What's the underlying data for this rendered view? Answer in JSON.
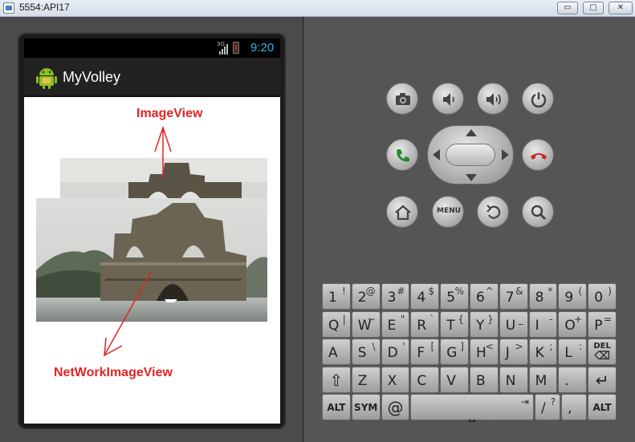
{
  "window": {
    "title": "5554:API17",
    "minimize_glyph": "▭",
    "maximize_glyph": "▢",
    "close_glyph": "✕"
  },
  "statusbar": {
    "network_type": "3G",
    "time": "9:20",
    "clock_color": "#33b5e5"
  },
  "actionbar": {
    "app_title": "MyVolley",
    "icon": "android-icon"
  },
  "annotations": {
    "image_view_label": "ImageView",
    "network_image_view_label": "NetWorkImageView",
    "color": "#e02424"
  },
  "hardware_buttons": {
    "camera": "camera-icon",
    "volume_down": "volume-down-icon",
    "volume_up": "volume-up-icon",
    "power": "power-icon",
    "call": "call-icon",
    "end_call": "end-call-icon",
    "home": "home-icon",
    "menu_label": "MENU",
    "back": "back-icon",
    "search": "search-icon"
  },
  "keyboard": {
    "row1": [
      {
        "main": "1",
        "alt": "!"
      },
      {
        "main": "2",
        "alt": "@"
      },
      {
        "main": "3",
        "alt": "#"
      },
      {
        "main": "4",
        "alt": "$"
      },
      {
        "main": "5",
        "alt": "%"
      },
      {
        "main": "6",
        "alt": "^"
      },
      {
        "main": "7",
        "alt": "&"
      },
      {
        "main": "8",
        "alt": "*"
      },
      {
        "main": "9",
        "alt": "("
      },
      {
        "main": "0",
        "alt": ")"
      }
    ],
    "row2": [
      {
        "main": "Q",
        "alt": "|"
      },
      {
        "main": "W",
        "alt": "~"
      },
      {
        "main": "E",
        "alt": "\""
      },
      {
        "main": "R",
        "alt": "`"
      },
      {
        "main": "T",
        "alt": "{"
      },
      {
        "main": "Y",
        "alt": "}"
      },
      {
        "main": "U",
        "alt": "_"
      },
      {
        "main": "I",
        "alt": "-"
      },
      {
        "main": "O",
        "alt": "+"
      },
      {
        "main": "P",
        "alt": "="
      }
    ],
    "row3": [
      {
        "main": "A",
        "alt": ""
      },
      {
        "main": "S",
        "alt": "\\"
      },
      {
        "main": "D",
        "alt": "'"
      },
      {
        "main": "F",
        "alt": "["
      },
      {
        "main": "G",
        "alt": "]"
      },
      {
        "main": "H",
        "alt": "<"
      },
      {
        "main": "J",
        "alt": ">"
      },
      {
        "main": "K",
        "alt": ";"
      },
      {
        "main": "L",
        "alt": ":"
      }
    ],
    "del_label": "DEL",
    "del_glyph": "⌫",
    "row4": [
      {
        "main": "Z",
        "alt": ""
      },
      {
        "main": "X",
        "alt": ""
      },
      {
        "main": "C",
        "alt": ""
      },
      {
        "main": "V",
        "alt": ""
      },
      {
        "main": "B",
        "alt": ""
      },
      {
        "main": "N",
        "alt": ""
      },
      {
        "main": "M",
        "alt": ""
      },
      {
        "main": ".",
        "alt": ""
      }
    ],
    "shift_glyph": "⇧",
    "enter_glyph": "↵",
    "alt_label": "ALT",
    "sym_label": "SYM",
    "at_label": "@",
    "space_glyph": "⎵",
    "tab_glyph": "⇥",
    "slash_label": "/",
    "question_label": "?",
    "comma_label": ","
  }
}
